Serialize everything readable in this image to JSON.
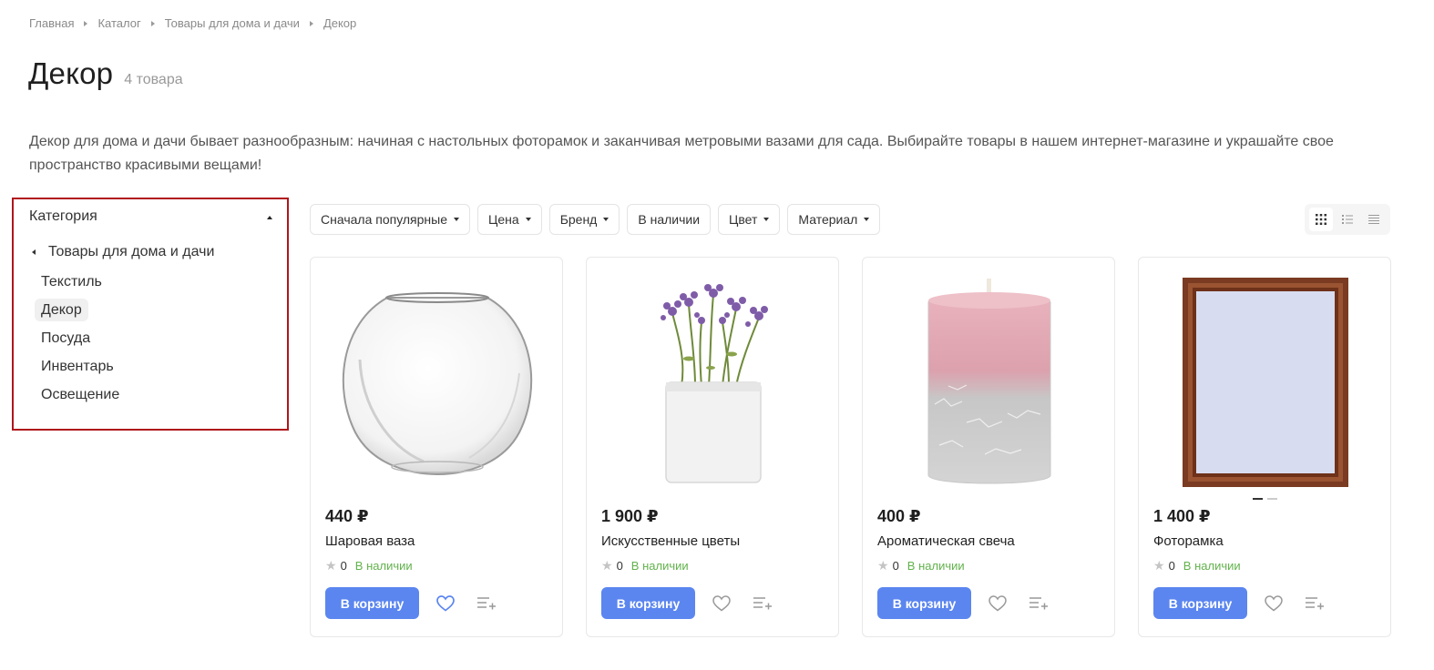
{
  "breadcrumb": [
    "Главная",
    "Каталог",
    "Товары для дома и дачи",
    "Декор"
  ],
  "page": {
    "title": "Декор",
    "count": "4 товара",
    "description": "Декор для дома и дачи бывает разнообразным: начиная с настольных фоторамок и заканчивая метровыми вазами для сада. Выбирайте товары в нашем интернет-магазине и украшайте свое пространство красивыми вещами!"
  },
  "sidebar": {
    "heading": "Категория",
    "parent": "Товары для дома и дачи",
    "items": [
      "Текстиль",
      "Декор",
      "Посуда",
      "Инвентарь",
      "Освещение"
    ],
    "active_index": 1,
    "border_color": "#b0151c"
  },
  "filters": [
    {
      "label": "Сначала популярные",
      "dropdown": true
    },
    {
      "label": "Цена",
      "dropdown": true
    },
    {
      "label": "Бренд",
      "dropdown": true
    },
    {
      "label": "В наличии",
      "dropdown": false
    },
    {
      "label": "Цвет",
      "dropdown": true
    },
    {
      "label": "Материал",
      "dropdown": true
    }
  ],
  "view_modes": [
    "grid-view-icon",
    "list-view-icon",
    "compact-list-icon"
  ],
  "products": [
    {
      "price": "440 ₽",
      "name": "Шаровая ваза",
      "rating": "0",
      "stock": "В наличии",
      "buy_label": "В корзину",
      "image": "glass-vase-icon"
    },
    {
      "price": "1 900 ₽",
      "name": "Искусственные цветы",
      "rating": "0",
      "stock": "В наличии",
      "buy_label": "В корзину",
      "image": "flowers-pot-icon"
    },
    {
      "price": "400 ₽",
      "name": "Ароматическая свеча",
      "rating": "0",
      "stock": "В наличии",
      "buy_label": "В корзину",
      "image": "candle-icon"
    },
    {
      "price": "1 400 ₽",
      "name": "Фоторамка",
      "rating": "0",
      "stock": "В наличии",
      "buy_label": "В корзину",
      "image": "photo-frame-icon"
    }
  ],
  "colors": {
    "accent": "#5b86f0",
    "stock": "#62b24c",
    "favorite_active": "#5b86f0"
  }
}
